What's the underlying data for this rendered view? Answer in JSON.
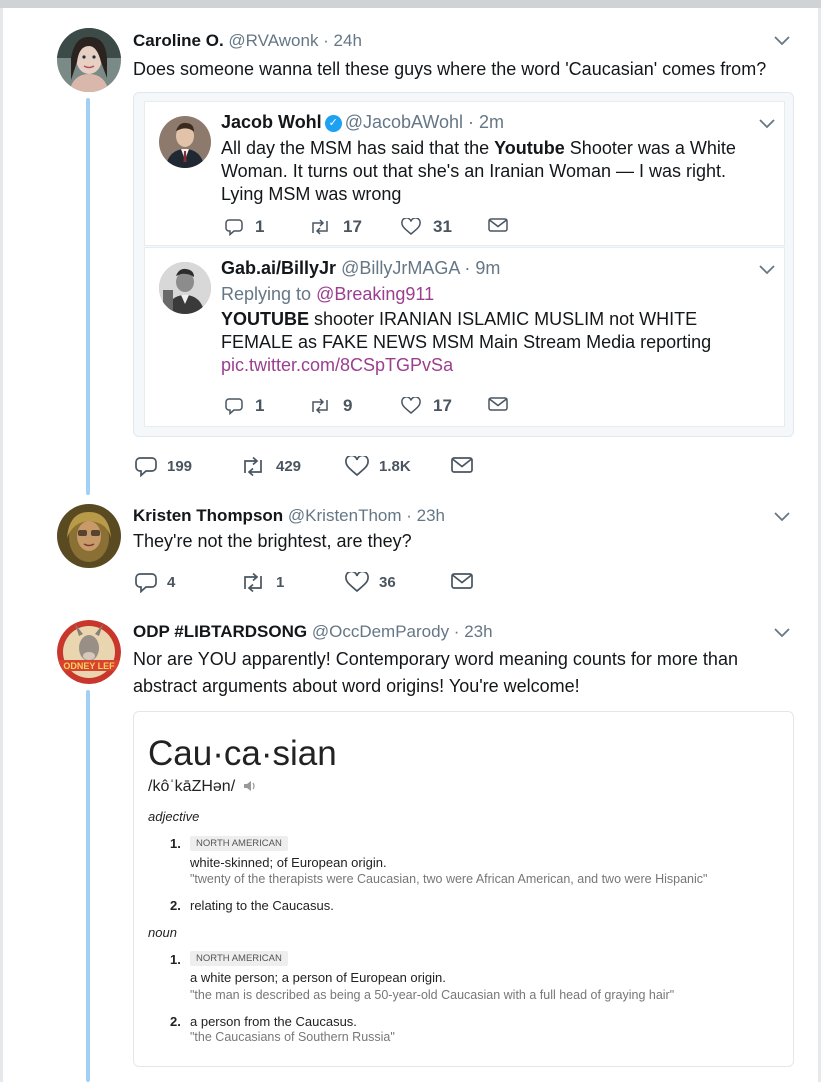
{
  "tweets": [
    {
      "name": "Caroline O.",
      "handle": "@RVAwonk · 24h",
      "text": "Does someone wanna tell these guys where the word 'Caucasian' comes from?",
      "quoted": [
        {
          "name": "Jacob Wohl",
          "handle": "@JacobAWohl · 2m",
          "text_parts": [
            "All day the MSM has said that the ",
            "Youtube",
            " Shooter was a White Woman. It turns out that she's an Iranian Woman — I was right. Lying MSM was wrong"
          ],
          "replies": "1",
          "retweets": "17",
          "likes": "31"
        },
        {
          "name": "Gab.ai/BillyJr",
          "handle": "@BillyJrMAGA · 9m",
          "replying_prefix": "Replying to ",
          "replying_to": "@Breaking911",
          "text_parts": [
            "YOUTUBE",
            " shooter IRANIAN ISLAMIC MUSLIM not WHITE FEMALE as FAKE NEWS MSM Main Stream Media reporting"
          ],
          "link": "pic.twitter.com/8CSpTGPvSa",
          "replies": "1",
          "retweets": "9",
          "likes": "17"
        }
      ],
      "replies": "199",
      "retweets": "429",
      "likes": "1.8K"
    },
    {
      "name": "Kristen Thompson",
      "handle": "@KristenThom · 23h",
      "text": "They're not the brightest, are they?",
      "replies": "4",
      "retweets": "1",
      "likes": "36"
    },
    {
      "name": "ODP #LIBTARDSONG",
      "handle": "@OccDemParody · 23h",
      "text_lines": [
        "Nor are YOU apparently!  Contemporary word meaning counts for more than",
        "abstract arguments about word origins!  You're welcome!"
      ],
      "avatar_text": "ODNEY LEF"
    }
  ],
  "dictionary": {
    "word": "Cau·ca·sian",
    "pronunciation": "/kôˈkāZHən/",
    "adjective_label": "adjective",
    "noun_label": "noun",
    "adjective": [
      {
        "num": "1.",
        "region": "NORTH AMERICAN",
        "definition": "white-skinned; of European origin.",
        "example": "\"twenty of the therapists were Caucasian, two were African American, and two were Hispanic\""
      },
      {
        "num": "2.",
        "definition": "relating to the Caucasus."
      }
    ],
    "noun": [
      {
        "num": "1.",
        "region": "NORTH AMERICAN",
        "definition": "a white person; a person of European origin.",
        "example": "\"the man is described as being a 50-year-old Caucasian with a full head of graying hair\""
      },
      {
        "num": "2.",
        "definition": "a person from the Caucasus.",
        "example": "\"the Caucasians of Southern Russia\""
      }
    ]
  },
  "colors": {
    "thread_line": "#a3d0f5",
    "verified": "#1da1f2",
    "link": "#9b3e8f",
    "icon": "#4a5560"
  },
  "icons": [
    "reply-icon",
    "retweet-icon",
    "like-icon",
    "message-icon",
    "chevron-down-icon",
    "verified-badge-icon",
    "speaker-icon"
  ]
}
